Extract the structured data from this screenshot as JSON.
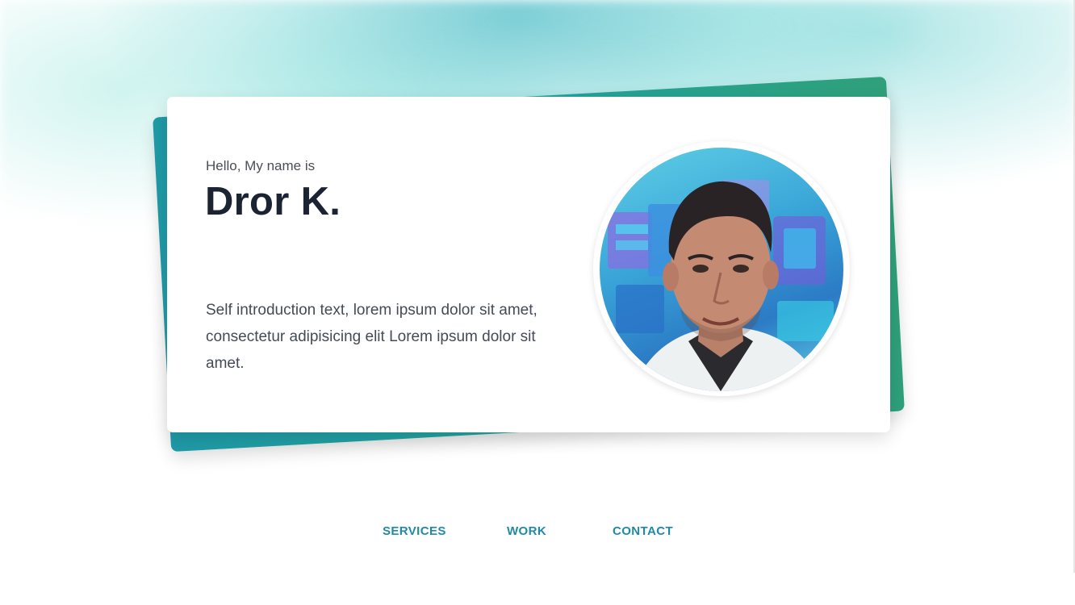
{
  "hero": {
    "greeting": "Hello, My name is",
    "name": "Dror K.",
    "intro": "Self introduction text, lorem ipsum dolor sit amet, consectetur adipisicing elit Lorem ipsum dolor sit amet."
  },
  "nav": {
    "items": [
      {
        "label": "SERVICES"
      },
      {
        "label": "WORK"
      },
      {
        "label": "CONTACT"
      }
    ]
  },
  "colors": {
    "accent": "#1f8aa8",
    "card_back_start": "#1f9aa6",
    "card_back_end": "#2fa07a",
    "heading": "#1c2333",
    "body_text": "#444b55"
  }
}
